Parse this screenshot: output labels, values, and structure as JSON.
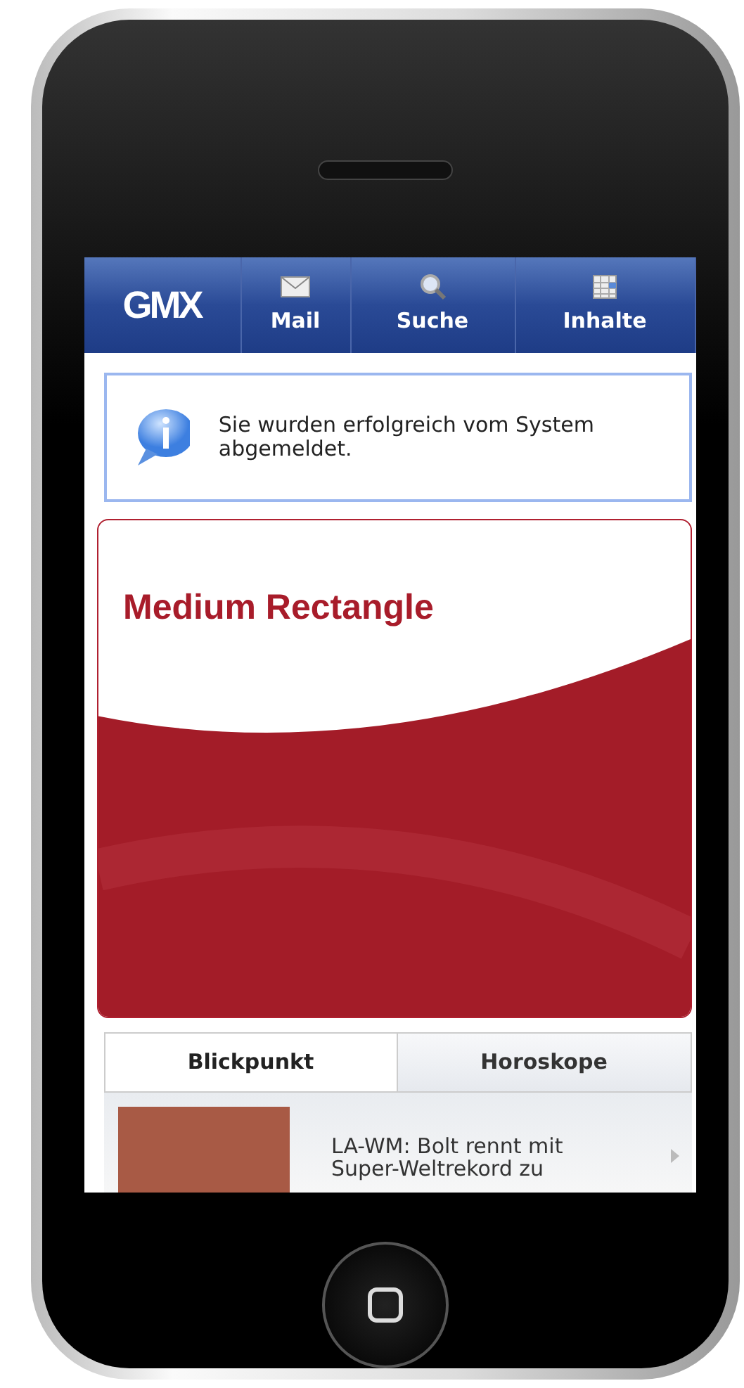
{
  "header": {
    "logo": "GMX",
    "tabs": [
      {
        "label": "Mail",
        "kind": "mail"
      },
      {
        "label": "Suche",
        "kind": "search"
      },
      {
        "label": "Inhalte",
        "kind": "content"
      }
    ]
  },
  "notice": {
    "text": "Sie wurden erfolgreich vom System abgemeldet."
  },
  "ad": {
    "title": "Medium Rectangle"
  },
  "news_tabs": [
    {
      "label": "Blickpunkt",
      "selected": true
    },
    {
      "label": "Horoskope",
      "selected": false
    }
  ],
  "news": [
    {
      "headline": "LA-WM: Bolt rennt mit Super-Weltrekord zu"
    }
  ]
}
